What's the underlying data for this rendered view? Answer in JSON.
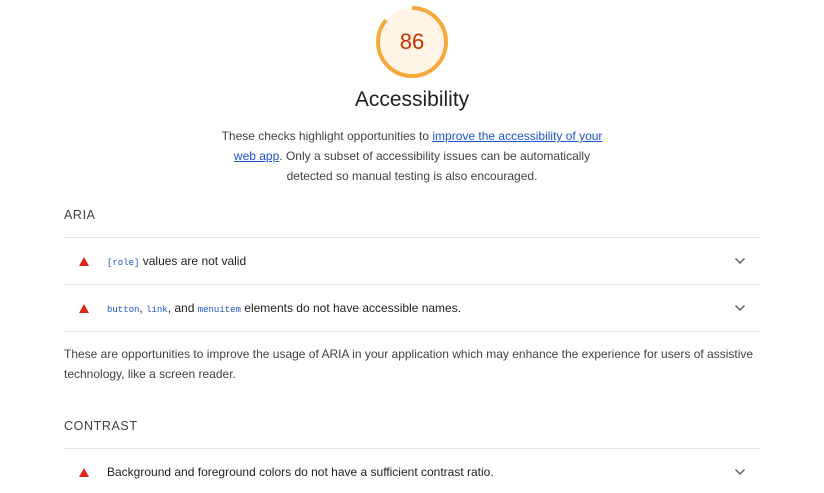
{
  "score": {
    "value": "86",
    "fraction": 0.86,
    "ring_color": "#f4a93a",
    "track_color": "#fff4e6",
    "text_color": "#c33300"
  },
  "category_title": "Accessibility",
  "description": {
    "before": "These checks highlight opportunities to ",
    "link": "improve the accessibility of your web app",
    "after": ". Only a subset of accessibility issues can be automatically detected so manual testing is also encouraged."
  },
  "groups": {
    "aria": {
      "title": "ARIA",
      "audits": [
        {
          "code1": "[role]",
          "text": " values are not valid",
          "icon": "warning-triangle-icon"
        },
        {
          "code1": "button",
          "sep1": ", ",
          "code2": "link",
          "sep2": ", and ",
          "code3": "menuitem",
          "text": " elements do not have accessible names.",
          "icon": "warning-triangle-icon"
        }
      ],
      "description": "These are opportunities to improve the usage of ARIA in your application which may enhance the experience for users of assistive technology, like a screen reader."
    },
    "contrast": {
      "title": "CONTRAST",
      "audits": [
        {
          "text": "Background and foreground colors do not have a sufficient contrast ratio.",
          "icon": "warning-triangle-icon"
        }
      ]
    }
  },
  "colors": {
    "fail": "#e0251b",
    "link": "#1a56c9"
  }
}
